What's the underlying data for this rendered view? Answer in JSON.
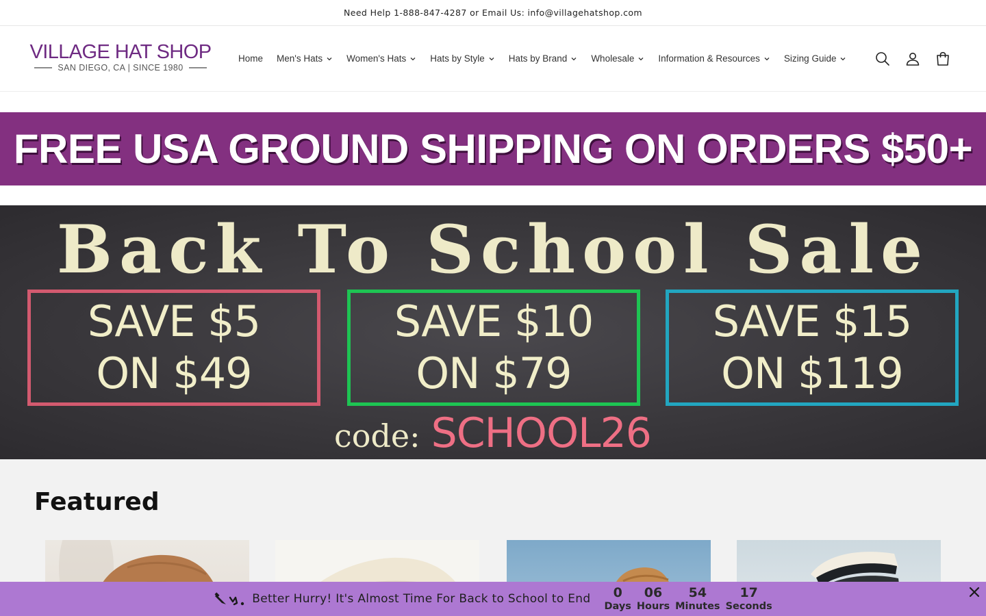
{
  "announcement": {
    "text": "Need Help 1-888-847-4287 or Email Us: info@villagehatshop.com"
  },
  "logo": {
    "name": "VILLAGE HAT SHOP",
    "tagline": "SAN DIEGO, CA | SINCE 1980"
  },
  "nav": {
    "items": [
      {
        "label": "Home",
        "has_dropdown": false
      },
      {
        "label": "Men's Hats",
        "has_dropdown": true
      },
      {
        "label": "Women's Hats",
        "has_dropdown": true
      },
      {
        "label": "Hats by Style",
        "has_dropdown": true
      },
      {
        "label": "Hats by Brand",
        "has_dropdown": true
      },
      {
        "label": "Wholesale",
        "has_dropdown": true
      },
      {
        "label": "Information & Resources",
        "has_dropdown": true
      },
      {
        "label": "Sizing Guide",
        "has_dropdown": true
      }
    ]
  },
  "header_icons": [
    "search-icon",
    "account-icon",
    "cart-icon"
  ],
  "shipping_banner": {
    "text": "FREE USA GROUND SHIPPING ON ORDERS $50+",
    "color": "#833080"
  },
  "hero": {
    "title": "Back To School Sale",
    "deals": [
      {
        "line1": "SAVE $5",
        "line2": "ON $49",
        "border_color": "#d35a6f"
      },
      {
        "line1": "SAVE $10",
        "line2": "ON $79",
        "border_color": "#1ec453"
      },
      {
        "line1": "SAVE $15",
        "line2": "ON $119",
        "border_color": "#22a6c0"
      }
    ],
    "code_label": "code:",
    "code_value": "SCHOOL26"
  },
  "featured": {
    "title": "Featured"
  },
  "countdown": {
    "message": "Better Hurry! It's Almost Time For Back to School to End",
    "icon": "pencil-ruler-icon",
    "units": [
      {
        "value": "0",
        "label": "Days"
      },
      {
        "value": "06",
        "label": "Hours"
      },
      {
        "value": "54",
        "label": "Minutes"
      },
      {
        "value": "17",
        "label": "Seconds"
      }
    ],
    "bg_color": "#ad78d2"
  }
}
